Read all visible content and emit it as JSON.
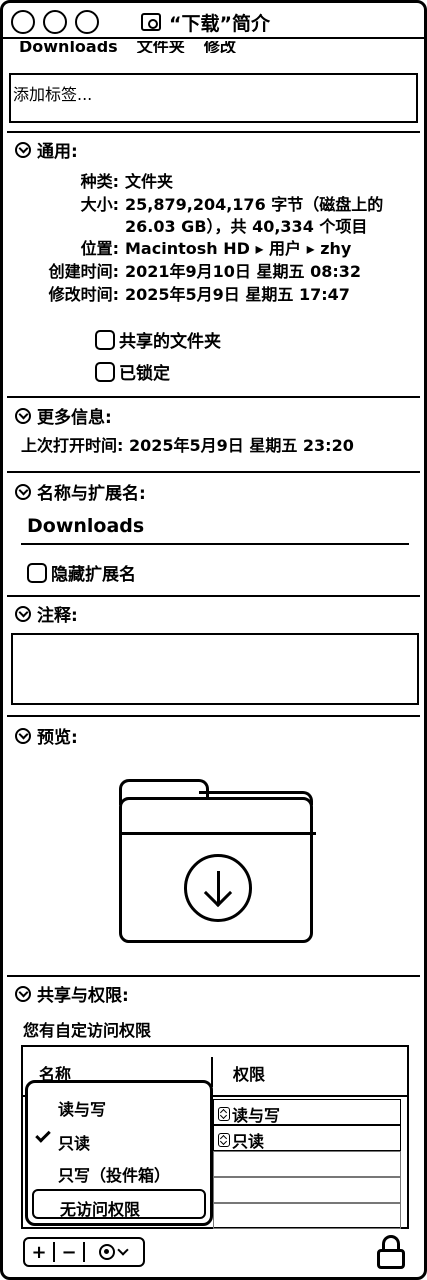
{
  "window": {
    "title": "“下载”简介"
  },
  "clipped_header": [
    "Downloads",
    "文件夹",
    "修改"
  ],
  "tags": {
    "placeholder": "添加标签..."
  },
  "general": {
    "header": "通用:",
    "kind_label": "种类:",
    "kind_value": "文件夹",
    "size_label": "大小:",
    "size_value_1": "25,879,204,176 字节（磁盘上的",
    "size_value_2": "26.03 GB），共 40,334 个项目",
    "where_label": "位置:",
    "where_value": "Macintosh HD ▸ 用户 ▸ zhy",
    "created_label": "创建时间:",
    "created_value": "2021年9月10日 星期五 08:32",
    "modified_label": "修改时间:",
    "modified_value": "2025年5月9日 星期五 17:47",
    "shared_folder_label": "共享的文件夹",
    "locked_label": "已锁定"
  },
  "more_info": {
    "header": "更多信息:",
    "last_opened": "上次打开时间: 2025年5月9日 星期五 23:20"
  },
  "name_ext": {
    "header": "名称与扩展名:",
    "name_value": "Downloads",
    "hide_ext_label": "隐藏扩展名"
  },
  "comments": {
    "header": "注释:"
  },
  "preview": {
    "header": "预览:"
  },
  "sharing": {
    "header": "共享与权限:",
    "subtitle": "您有自定访问权限",
    "col_name": "名称",
    "col_privilege": "权限",
    "rows": [
      "读与写",
      "只读"
    ],
    "popup_items": [
      "读与写",
      "只读",
      "只写（投件箱）",
      "无访问权限"
    ],
    "popup_checked_index": 1,
    "popup_selected_index": 3
  },
  "toolbar": {
    "add": "+",
    "remove": "−"
  }
}
